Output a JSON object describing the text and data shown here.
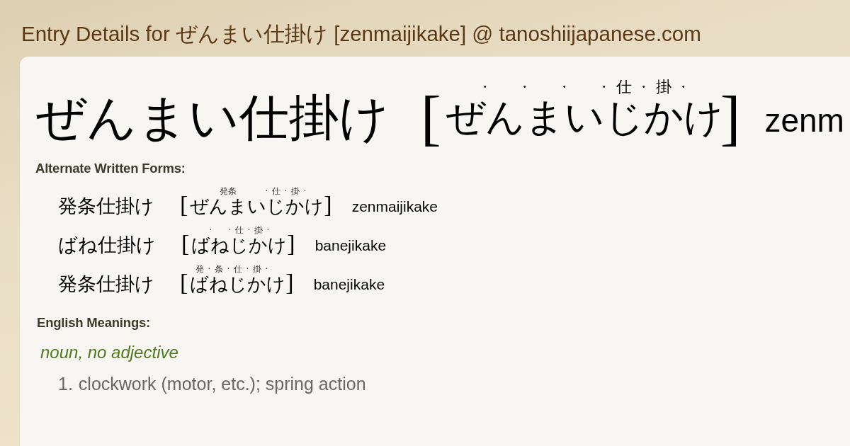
{
  "page_title": "Entry Details for ぜんまい仕掛け [zenmaijikake] @ tanoshiijapanese.com",
  "entry": {
    "word": "ぜんまい仕掛け",
    "open_bracket": "[",
    "reading": [
      {
        "kind": "kana",
        "kana": "ぜ"
      },
      {
        "kind": "sep",
        "mark": "·"
      },
      {
        "kind": "kana",
        "kana": "ん"
      },
      {
        "kind": "sep",
        "mark": "·"
      },
      {
        "kind": "kana",
        "kana": "ま"
      },
      {
        "kind": "sep",
        "mark": "·"
      },
      {
        "kind": "kana",
        "kana": "い"
      },
      {
        "kind": "sep",
        "mark": "·"
      },
      {
        "kind": "kana",
        "kana": "じ",
        "ruby": "仕"
      },
      {
        "kind": "sep",
        "mark": "·"
      },
      {
        "kind": "kana",
        "kana": "か",
        "ruby": "掛"
      },
      {
        "kind": "sep",
        "mark": "·"
      },
      {
        "kind": "kana",
        "kana": "け"
      }
    ],
    "close_bracket": "]",
    "romaji": "zenm"
  },
  "alternate_forms": {
    "heading": "Alternate Written Forms:",
    "forms": [
      {
        "word": "発条仕掛け",
        "open_bracket": "[",
        "reading": [
          {
            "kind": "kana",
            "kana": "ぜんまい",
            "ruby": "発条"
          },
          {
            "kind": "sep",
            "mark": "·"
          },
          {
            "kind": "kana",
            "kana": "じ",
            "ruby": "仕"
          },
          {
            "kind": "sep",
            "mark": "·"
          },
          {
            "kind": "kana",
            "kana": "か",
            "ruby": "掛"
          },
          {
            "kind": "sep",
            "mark": "·"
          },
          {
            "kind": "kana",
            "kana": "け"
          }
        ],
        "close_bracket": "]",
        "romaji": "zenmaijikake"
      },
      {
        "word": "ばね仕掛け",
        "open_bracket": "[",
        "reading": [
          {
            "kind": "kana",
            "kana": "ば"
          },
          {
            "kind": "sep",
            "mark": "·"
          },
          {
            "kind": "kana",
            "kana": "ね"
          },
          {
            "kind": "sep",
            "mark": "·"
          },
          {
            "kind": "kana",
            "kana": "じ",
            "ruby": "仕"
          },
          {
            "kind": "sep",
            "mark": "·"
          },
          {
            "kind": "kana",
            "kana": "か",
            "ruby": "掛"
          },
          {
            "kind": "sep",
            "mark": "·"
          },
          {
            "kind": "kana",
            "kana": "け"
          }
        ],
        "close_bracket": "]",
        "romaji": "banejikake"
      },
      {
        "word": "発条仕掛け",
        "open_bracket": "[",
        "reading": [
          {
            "kind": "kana",
            "kana": "ば",
            "ruby": "発"
          },
          {
            "kind": "sep",
            "mark": "·"
          },
          {
            "kind": "kana",
            "kana": "ね",
            "ruby": "条"
          },
          {
            "kind": "sep",
            "mark": "·"
          },
          {
            "kind": "kana",
            "kana": "じ",
            "ruby": "仕"
          },
          {
            "kind": "sep",
            "mark": "·"
          },
          {
            "kind": "kana",
            "kana": "か",
            "ruby": "掛"
          },
          {
            "kind": "sep",
            "mark": "·"
          },
          {
            "kind": "kana",
            "kana": "け"
          }
        ],
        "close_bracket": "]",
        "romaji": "banejikake"
      }
    ]
  },
  "meanings": {
    "heading": "English Meanings:",
    "part_of_speech": "noun, no adjective",
    "senses": [
      {
        "number": "1.",
        "text": "clockwork (motor, etc.); spring action"
      }
    ]
  }
}
